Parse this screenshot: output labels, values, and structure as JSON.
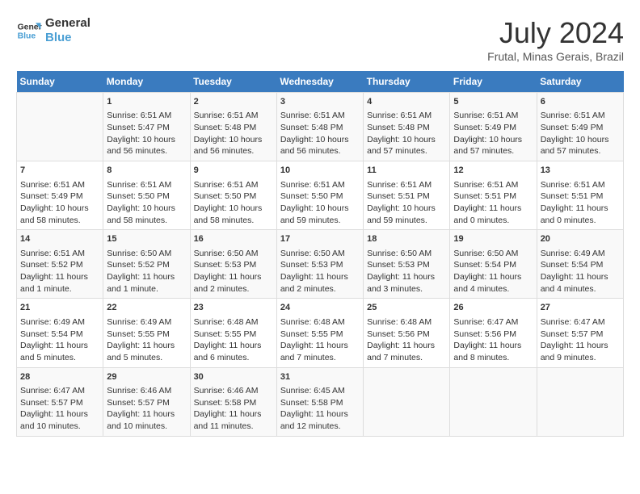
{
  "header": {
    "logo": {
      "line1": "General",
      "line2": "Blue"
    },
    "title": "July 2024",
    "location": "Frutal, Minas Gerais, Brazil"
  },
  "days_of_week": [
    "Sunday",
    "Monday",
    "Tuesday",
    "Wednesday",
    "Thursday",
    "Friday",
    "Saturday"
  ],
  "weeks": [
    [
      {
        "day": "",
        "content": ""
      },
      {
        "day": "1",
        "content": "Sunrise: 6:51 AM\nSunset: 5:47 PM\nDaylight: 10 hours\nand 56 minutes."
      },
      {
        "day": "2",
        "content": "Sunrise: 6:51 AM\nSunset: 5:48 PM\nDaylight: 10 hours\nand 56 minutes."
      },
      {
        "day": "3",
        "content": "Sunrise: 6:51 AM\nSunset: 5:48 PM\nDaylight: 10 hours\nand 56 minutes."
      },
      {
        "day": "4",
        "content": "Sunrise: 6:51 AM\nSunset: 5:48 PM\nDaylight: 10 hours\nand 57 minutes."
      },
      {
        "day": "5",
        "content": "Sunrise: 6:51 AM\nSunset: 5:49 PM\nDaylight: 10 hours\nand 57 minutes."
      },
      {
        "day": "6",
        "content": "Sunrise: 6:51 AM\nSunset: 5:49 PM\nDaylight: 10 hours\nand 57 minutes."
      }
    ],
    [
      {
        "day": "7",
        "content": "Sunrise: 6:51 AM\nSunset: 5:49 PM\nDaylight: 10 hours\nand 58 minutes."
      },
      {
        "day": "8",
        "content": "Sunrise: 6:51 AM\nSunset: 5:50 PM\nDaylight: 10 hours\nand 58 minutes."
      },
      {
        "day": "9",
        "content": "Sunrise: 6:51 AM\nSunset: 5:50 PM\nDaylight: 10 hours\nand 58 minutes."
      },
      {
        "day": "10",
        "content": "Sunrise: 6:51 AM\nSunset: 5:50 PM\nDaylight: 10 hours\nand 59 minutes."
      },
      {
        "day": "11",
        "content": "Sunrise: 6:51 AM\nSunset: 5:51 PM\nDaylight: 10 hours\nand 59 minutes."
      },
      {
        "day": "12",
        "content": "Sunrise: 6:51 AM\nSunset: 5:51 PM\nDaylight: 11 hours\nand 0 minutes."
      },
      {
        "day": "13",
        "content": "Sunrise: 6:51 AM\nSunset: 5:51 PM\nDaylight: 11 hours\nand 0 minutes."
      }
    ],
    [
      {
        "day": "14",
        "content": "Sunrise: 6:51 AM\nSunset: 5:52 PM\nDaylight: 11 hours\nand 1 minute."
      },
      {
        "day": "15",
        "content": "Sunrise: 6:50 AM\nSunset: 5:52 PM\nDaylight: 11 hours\nand 1 minute."
      },
      {
        "day": "16",
        "content": "Sunrise: 6:50 AM\nSunset: 5:53 PM\nDaylight: 11 hours\nand 2 minutes."
      },
      {
        "day": "17",
        "content": "Sunrise: 6:50 AM\nSunset: 5:53 PM\nDaylight: 11 hours\nand 2 minutes."
      },
      {
        "day": "18",
        "content": "Sunrise: 6:50 AM\nSunset: 5:53 PM\nDaylight: 11 hours\nand 3 minutes."
      },
      {
        "day": "19",
        "content": "Sunrise: 6:50 AM\nSunset: 5:54 PM\nDaylight: 11 hours\nand 4 minutes."
      },
      {
        "day": "20",
        "content": "Sunrise: 6:49 AM\nSunset: 5:54 PM\nDaylight: 11 hours\nand 4 minutes."
      }
    ],
    [
      {
        "day": "21",
        "content": "Sunrise: 6:49 AM\nSunset: 5:54 PM\nDaylight: 11 hours\nand 5 minutes."
      },
      {
        "day": "22",
        "content": "Sunrise: 6:49 AM\nSunset: 5:55 PM\nDaylight: 11 hours\nand 5 minutes."
      },
      {
        "day": "23",
        "content": "Sunrise: 6:48 AM\nSunset: 5:55 PM\nDaylight: 11 hours\nand 6 minutes."
      },
      {
        "day": "24",
        "content": "Sunrise: 6:48 AM\nSunset: 5:55 PM\nDaylight: 11 hours\nand 7 minutes."
      },
      {
        "day": "25",
        "content": "Sunrise: 6:48 AM\nSunset: 5:56 PM\nDaylight: 11 hours\nand 7 minutes."
      },
      {
        "day": "26",
        "content": "Sunrise: 6:47 AM\nSunset: 5:56 PM\nDaylight: 11 hours\nand 8 minutes."
      },
      {
        "day": "27",
        "content": "Sunrise: 6:47 AM\nSunset: 5:57 PM\nDaylight: 11 hours\nand 9 minutes."
      }
    ],
    [
      {
        "day": "28",
        "content": "Sunrise: 6:47 AM\nSunset: 5:57 PM\nDaylight: 11 hours\nand 10 minutes."
      },
      {
        "day": "29",
        "content": "Sunrise: 6:46 AM\nSunset: 5:57 PM\nDaylight: 11 hours\nand 10 minutes."
      },
      {
        "day": "30",
        "content": "Sunrise: 6:46 AM\nSunset: 5:58 PM\nDaylight: 11 hours\nand 11 minutes."
      },
      {
        "day": "31",
        "content": "Sunrise: 6:45 AM\nSunset: 5:58 PM\nDaylight: 11 hours\nand 12 minutes."
      },
      {
        "day": "",
        "content": ""
      },
      {
        "day": "",
        "content": ""
      },
      {
        "day": "",
        "content": ""
      }
    ]
  ]
}
